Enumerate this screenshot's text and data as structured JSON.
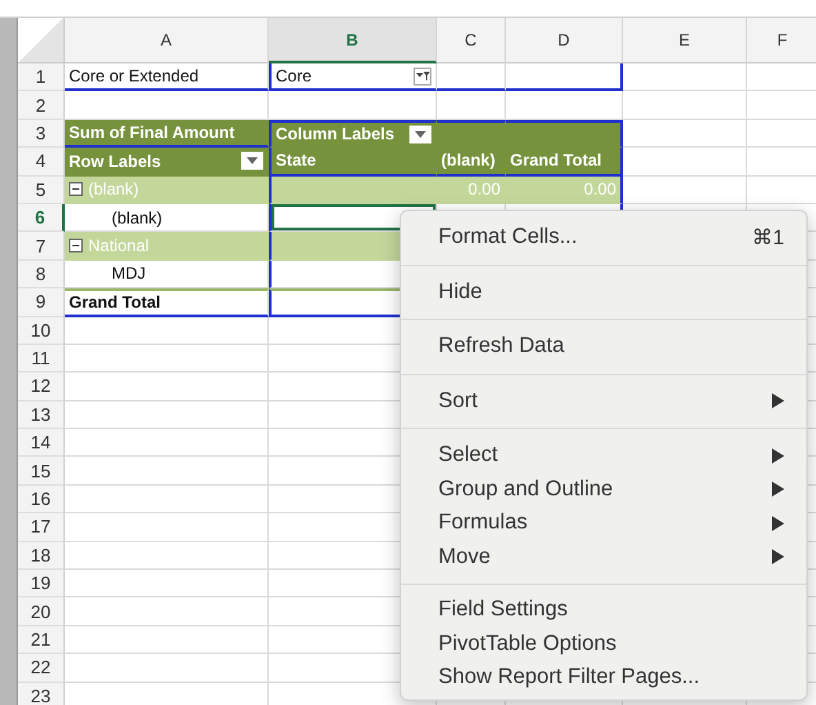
{
  "columns": [
    {
      "label": "A",
      "selected": false
    },
    {
      "label": "B",
      "selected": true
    },
    {
      "label": "C",
      "selected": false
    },
    {
      "label": "D",
      "selected": false
    },
    {
      "label": "E",
      "selected": false
    },
    {
      "label": "F",
      "selected": false
    }
  ],
  "rows": [
    {
      "number": "1",
      "selected": false,
      "kind": "filter",
      "cells": [
        "Core or Extended",
        "Core",
        "",
        ""
      ]
    },
    {
      "number": "2",
      "selected": false,
      "kind": "empty",
      "cells": []
    },
    {
      "number": "3",
      "selected": false,
      "kind": "pivot-header",
      "cells": [
        "Sum of Final Amount",
        "Column Labels",
        "",
        ""
      ]
    },
    {
      "number": "4",
      "selected": false,
      "kind": "pivot-subheader",
      "cells": [
        "Row Labels",
        "State",
        "(blank)",
        "Grand Total"
      ]
    },
    {
      "number": "5",
      "selected": false,
      "kind": "group",
      "cells": [
        "(blank)",
        "",
        "0.00",
        "0.00"
      ]
    },
    {
      "number": "6",
      "selected": true,
      "kind": "item",
      "cells": [
        "(blank)",
        "",
        "",
        ""
      ]
    },
    {
      "number": "7",
      "selected": false,
      "kind": "group",
      "cells": [
        "National",
        "",
        "",
        ""
      ]
    },
    {
      "number": "8",
      "selected": false,
      "kind": "item",
      "cells": [
        "MDJ",
        "",
        "",
        ""
      ]
    },
    {
      "number": "9",
      "selected": false,
      "kind": "total",
      "cells": [
        "Grand Total",
        "",
        "",
        ""
      ]
    },
    {
      "number": "10",
      "selected": false,
      "kind": "empty",
      "cells": []
    },
    {
      "number": "11",
      "selected": false,
      "kind": "empty",
      "cells": []
    },
    {
      "number": "12",
      "selected": false,
      "kind": "empty",
      "cells": []
    },
    {
      "number": "13",
      "selected": false,
      "kind": "empty",
      "cells": []
    },
    {
      "number": "14",
      "selected": false,
      "kind": "empty",
      "cells": []
    },
    {
      "number": "15",
      "selected": false,
      "kind": "empty",
      "cells": []
    },
    {
      "number": "16",
      "selected": false,
      "kind": "empty",
      "cells": []
    },
    {
      "number": "17",
      "selected": false,
      "kind": "empty",
      "cells": []
    },
    {
      "number": "18",
      "selected": false,
      "kind": "empty",
      "cells": []
    },
    {
      "number": "19",
      "selected": false,
      "kind": "empty",
      "cells": []
    },
    {
      "number": "20",
      "selected": false,
      "kind": "empty",
      "cells": []
    },
    {
      "number": "21",
      "selected": false,
      "kind": "empty",
      "cells": []
    },
    {
      "number": "22",
      "selected": false,
      "kind": "empty",
      "cells": []
    },
    {
      "number": "23",
      "selected": false,
      "kind": "empty",
      "cells": []
    }
  ],
  "context_menu": {
    "groups": [
      [
        {
          "label": "Format Cells...",
          "shortcut": "⌘1",
          "submenu": false
        }
      ],
      [
        {
          "label": "Hide",
          "submenu": false
        }
      ],
      [
        {
          "label": "Refresh Data",
          "submenu": false
        }
      ],
      [
        {
          "label": "Sort",
          "submenu": true
        }
      ],
      [
        {
          "label": "Select",
          "submenu": true
        },
        {
          "label": "Group and Outline",
          "submenu": true
        },
        {
          "label": "Formulas",
          "submenu": true
        },
        {
          "label": "Move",
          "submenu": true
        }
      ],
      [
        {
          "label": "Field Settings",
          "submenu": false
        },
        {
          "label": "PivotTable Options",
          "submenu": false
        },
        {
          "label": "Show Report Filter Pages...",
          "submenu": false
        }
      ]
    ]
  }
}
